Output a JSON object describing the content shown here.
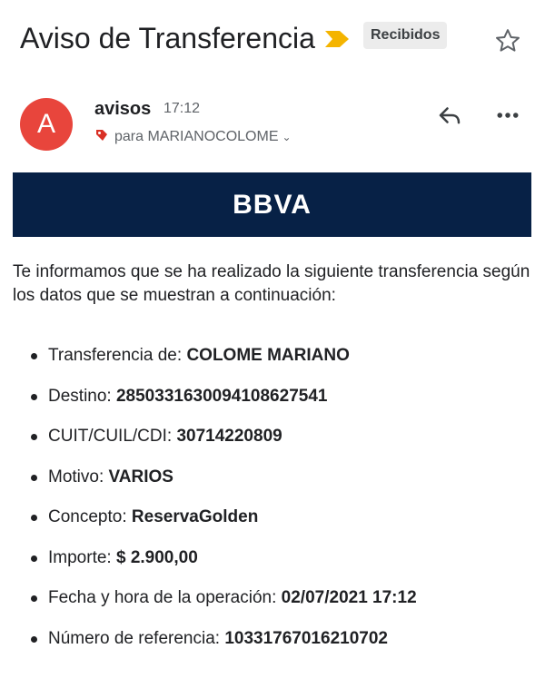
{
  "email": {
    "subject": "Aviso de Transferencia",
    "label": "Recibidos",
    "sender": "avisos",
    "avatar_letter": "A",
    "time": "17:12",
    "recipient": "para MARIANOCOLOME",
    "banner_logo": "BBVA",
    "intro": "Te informamos que se ha realizado la siguiente transferencia según los datos que se muestran a continuación:",
    "details": [
      {
        "label": "Transferencia de:",
        "value": "COLOME MARIANO"
      },
      {
        "label": "Destino:",
        "value": "2850331630094108627541"
      },
      {
        "label": "CUIT/CUIL/CDI:",
        "value": "30714220809"
      },
      {
        "label": "Motivo:",
        "value": "VARIOS"
      },
      {
        "label": "Concepto:",
        "value": "ReservaGolden"
      },
      {
        "label": "Importe:",
        "value": "$ 2.900,00"
      },
      {
        "label": "Fecha y hora de la operación:",
        "value": "02/07/2021 17:12"
      },
      {
        "label": "Número de referencia:",
        "value": "1033176701621070​2"
      }
    ]
  },
  "icons": {
    "importance": "importance-marker-icon",
    "star": "star-outline-icon",
    "reply": "reply-icon",
    "more": "more-horizontal-icon",
    "recipient_tag": "label-tag-icon",
    "expand": "chevron-down-icon"
  },
  "colors": {
    "avatar": "#e8453c",
    "importance": "#f4b400",
    "banner": "#072146",
    "label_chip": "#ececec",
    "recipient_tag": "#d93025"
  }
}
